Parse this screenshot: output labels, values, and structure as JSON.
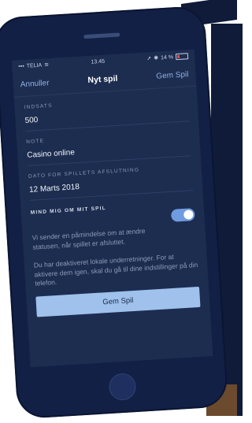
{
  "status_bar": {
    "carrier": "TELIA",
    "time": "13.45",
    "battery": "14 %"
  },
  "nav": {
    "cancel_label": "Annuller",
    "title": "Nyt spil",
    "save_label": "Gem Spil"
  },
  "fields": [
    {
      "label": "INDSATS",
      "value": "500"
    },
    {
      "label": "NOTE",
      "value": "Casino online"
    },
    {
      "label": "DATO FOR SPILLETS AFSLUTNING",
      "value": "12 Marts 2018"
    }
  ],
  "reminder": {
    "title": "MIND MIG OM MIT SPIL",
    "description": "Vi sender en påmindelse om at ændre statusen, når spillet er afsluttet.",
    "enabled": true
  },
  "notice": "Du har deaktiveret lokale underretninger. For at aktivere dem igen, skal du gå til dine indstillinger på din telefon.",
  "button": {
    "label": "Gem Spil"
  }
}
